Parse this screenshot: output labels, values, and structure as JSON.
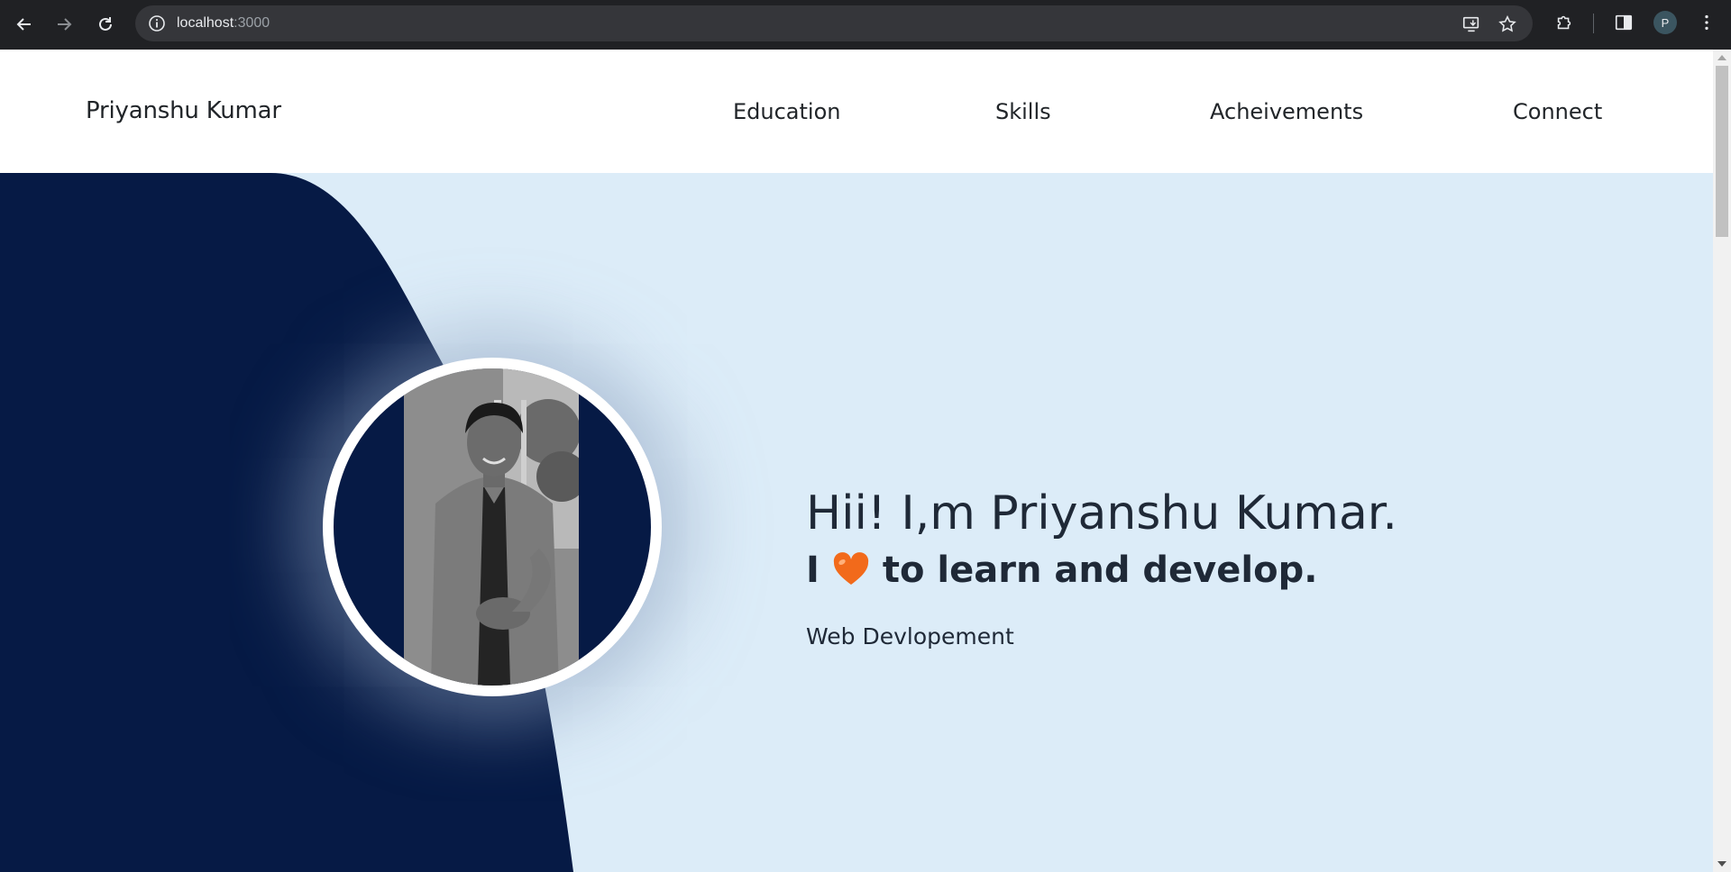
{
  "browser": {
    "url_host": "localhost",
    "url_port": ":3000",
    "profile_initial": "P",
    "icons": {
      "back": "back-arrow-icon",
      "forward": "forward-arrow-icon",
      "reload": "reload-icon",
      "site_info": "info-icon",
      "install": "install-app-icon",
      "bookmark": "star-icon",
      "extensions": "puzzle-icon",
      "side_panel": "side-panel-icon",
      "menu": "kebab-menu-icon"
    }
  },
  "site": {
    "brand": "Priyanshu Kumar",
    "nav": [
      {
        "label": "Education"
      },
      {
        "label": "Skills"
      },
      {
        "label": "Acheivements"
      },
      {
        "label": "Connect"
      }
    ]
  },
  "hero": {
    "greeting": "Hii! I,m Priyanshu Kumar.",
    "tagline_prefix": "I",
    "tagline_icon": "orange-heart-icon",
    "tagline_suffix": "to learn and develop.",
    "skill": "Web Devlopement"
  },
  "colors": {
    "chrome_bg": "#202124",
    "hero_bg": "#dcecf8",
    "navy": "#061a45",
    "heart": "#f26a1b",
    "text": "#1f2937"
  }
}
